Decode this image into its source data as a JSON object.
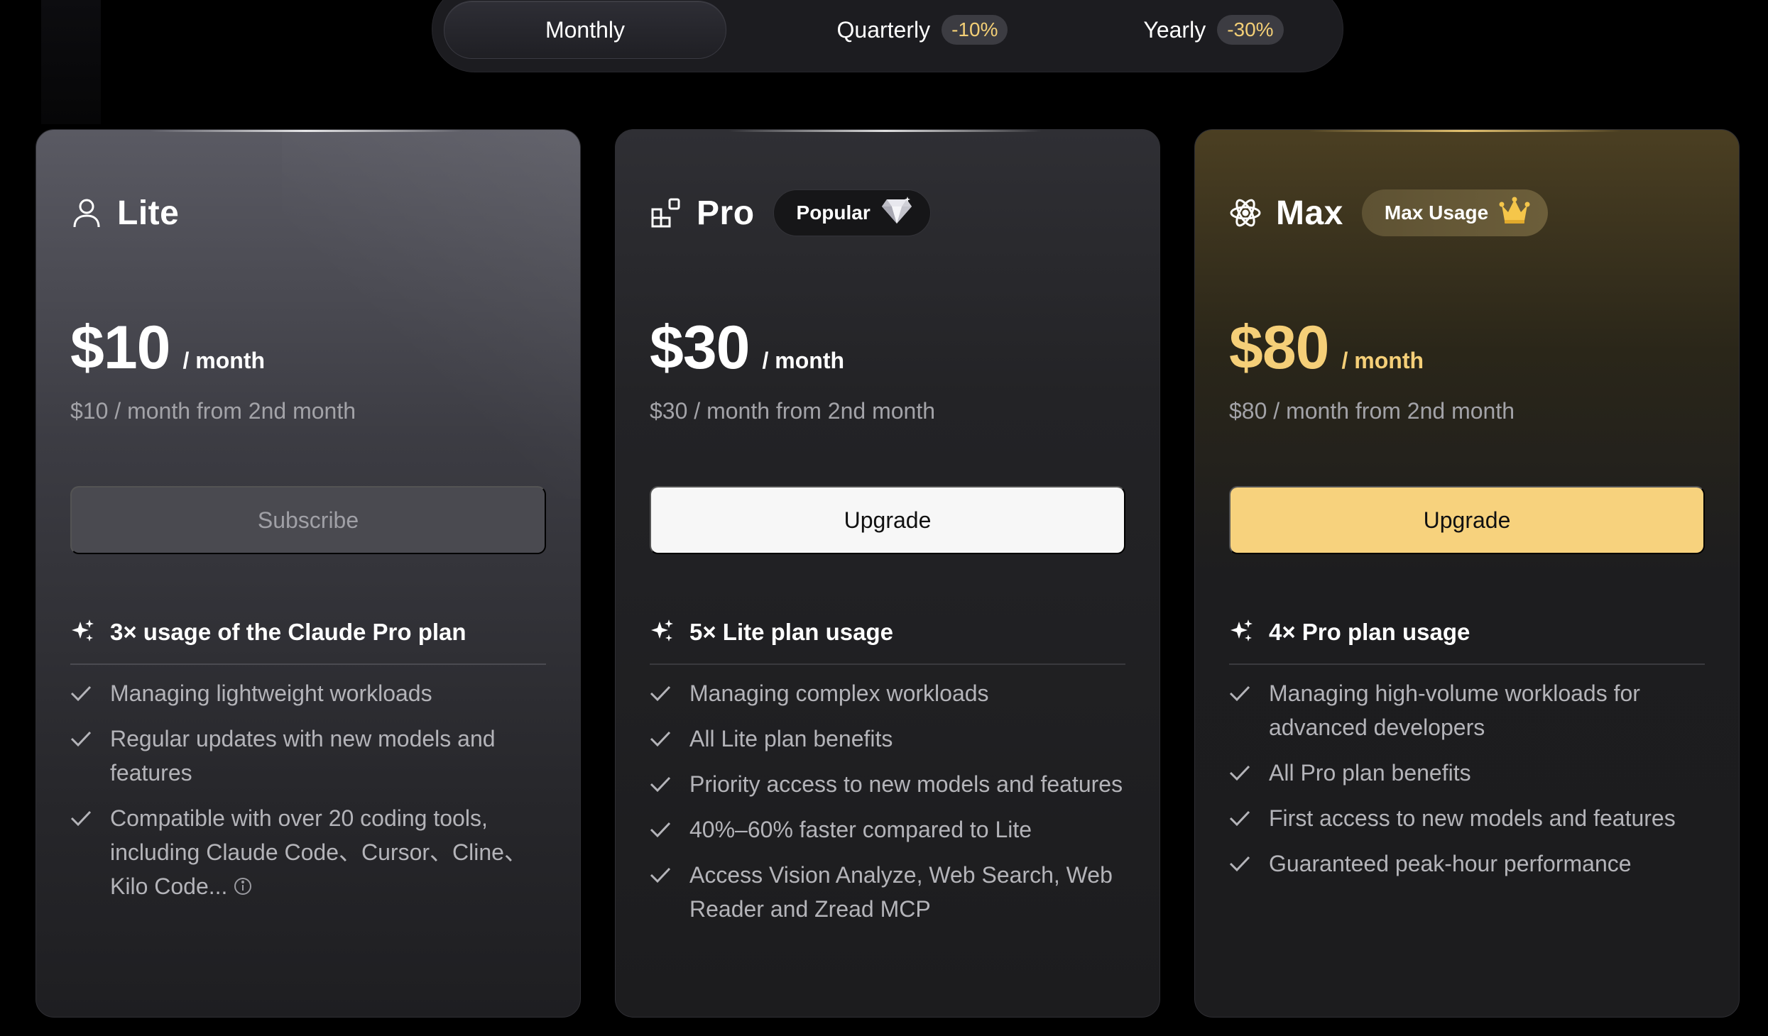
{
  "billing": {
    "monthly": "Monthly",
    "quarterly": "Quarterly",
    "quarterly_discount": "-10%",
    "yearly": "Yearly",
    "yearly_discount": "-30%"
  },
  "colors": {
    "gold": "#f5cf78",
    "gold_button": "#f7d27d",
    "background": "#000000"
  },
  "plans": [
    {
      "name": "Lite",
      "icon": "user-icon",
      "price": "$10",
      "period": "/ month",
      "renewal": "$10 / month from 2nd month",
      "button": "Subscribe",
      "usage_icon": "sparkle-icon",
      "usage": "3× usage of the Claude Pro plan",
      "features": [
        "Managing lightweight workloads",
        "Regular updates with new models and features",
        "Compatible with over 20 coding tools, including Claude Code、Cursor、Cline、Kilo Code..."
      ]
    },
    {
      "name": "Pro",
      "icon": "blocks-icon",
      "badge": "Popular",
      "badge_icon": "diamond-icon",
      "price": "$30",
      "period": "/ month",
      "renewal": "$30 / month from 2nd month",
      "button": "Upgrade",
      "usage_icon": "sparkle-icon",
      "usage": "5× Lite plan usage",
      "features": [
        "Managing complex workloads",
        "All Lite plan benefits",
        "Priority access to new models and features",
        "40%–60% faster compared to Lite",
        "Access Vision Analyze, Web Search, Web Reader and Zread MCP"
      ]
    },
    {
      "name": "Max",
      "icon": "atom-icon",
      "badge": "Max Usage",
      "badge_icon": "crown-icon",
      "price": "$80",
      "period": "/ month",
      "renewal": "$80 / month from 2nd month",
      "button": "Upgrade",
      "usage_icon": "sparkle-icon",
      "usage": "4× Pro plan usage",
      "features": [
        "Managing high-volume workloads for advanced developers",
        "All Pro plan benefits",
        "First access to new models and features",
        "Guaranteed peak-hour performance"
      ]
    }
  ]
}
